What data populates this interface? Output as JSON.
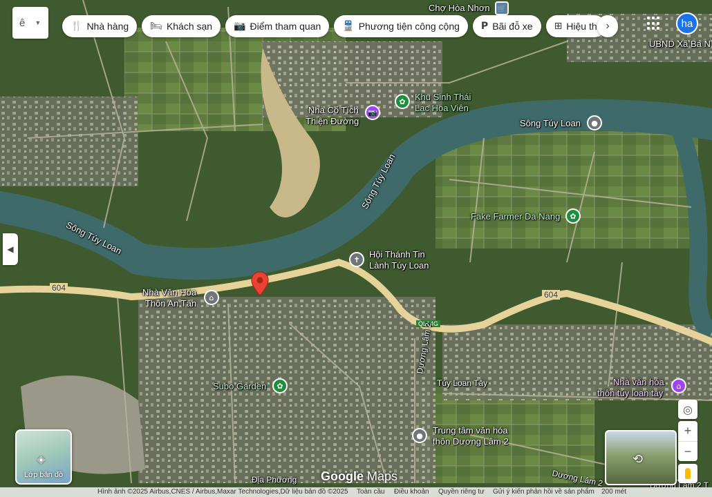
{
  "search": {
    "value": "ê"
  },
  "chips": [
    {
      "icon": "🍴",
      "icon_name": "restaurant-icon",
      "label": "Nhà hàng"
    },
    {
      "icon": "🛏",
      "icon_name": "hotel-icon",
      "label": "Khách sạn"
    },
    {
      "icon": "📷",
      "icon_name": "camera-icon",
      "label": "Điểm tham quan"
    },
    {
      "icon": "🚆",
      "icon_name": "transit-icon",
      "label": "Phương tiện công cộng"
    },
    {
      "icon": "P",
      "icon_name": "parking-icon",
      "label": "Bãi đỗ xe"
    },
    {
      "icon": "⊞",
      "icon_name": "pharmacy-icon",
      "label": "Hiệu thu"
    }
  ],
  "account": {
    "initials": "ha"
  },
  "places": {
    "cho_hoa_nhon": "Chợ Hòa Nhơn",
    "ubnd": "UBND Xã Ba N",
    "khu_sinh_thai_1": "Khu Sinh Thái",
    "khu_sinh_thai_2": "Lạc Hoa Viên",
    "nha_co_tich_1": "Nhà Cổ Tích",
    "nha_co_tich_2": "Thiện Đường",
    "song_tuy_loan_ne": "Sông Túy Loan",
    "song_tuy_loan_center": "Sông Túy Loan",
    "song_tuy_loan_west": "Sông Túy Loan",
    "fake_farmer": "Fake Farmer Da Nang",
    "hoi_thanh_1": "Hội Thánh Tin",
    "hoi_thanh_2": "Lành Túy Loan",
    "nha_van_hoa_1": "Nhà Văn Hóa",
    "nha_van_hoa_2": "Thôn An Tân",
    "subo": "Subo Garden",
    "nha_van_hoa_tuy_1": "Nhà văn hóa",
    "nha_van_hoa_tuy_2": "thôn túy loan tây",
    "trung_tam_1": "Trung tâm văn hóa",
    "trung_tam_2": "thôn Dương Lâm 2",
    "dia_phuong": "Địa Phương"
  },
  "roads": {
    "r604_west": "604",
    "r604_east": "604",
    "ql14g": "QL14G",
    "duong_lam_2": "Dương Lâm 2",
    "tuy_loan_tay": "Túy Loan Tây",
    "duong_lam_2_se": "Dương Lâm 2",
    "duong_lam_2_edge": "Dương Lâm 2 T"
  },
  "controls": {
    "layers_label": "Lớp bản đồ",
    "google": "Google",
    "maps": "Maps"
  },
  "footer": {
    "imagery": "Hình ảnh ©2025 Airbus,CNES / Airbus,Maxar Technologies,Dữ liệu bản đồ ©2025",
    "terms_short": "Toàn cầu",
    "terms": "Điều khoản",
    "privacy": "Quyền riêng tư",
    "feedback": "Gửi ý kiến phản hồi về sản phẩm",
    "scale": "200 mét"
  },
  "colors": {
    "river": "#3f6a6a",
    "main_road": "#e6d39a",
    "pin_red": "#ea4335",
    "green_pin": "#1e8e3e",
    "purple_pin": "#a142f4"
  }
}
